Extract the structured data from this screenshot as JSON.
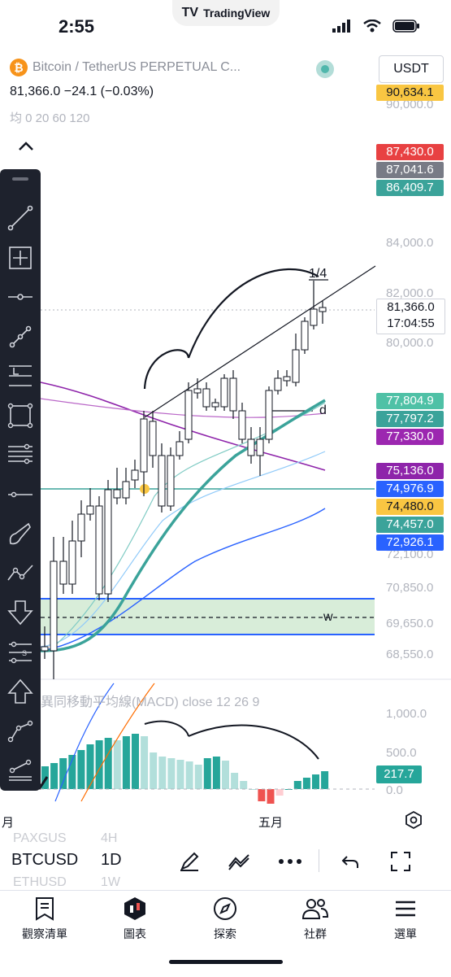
{
  "status": {
    "time": "2:55",
    "app_name": "TradingView"
  },
  "chart": {
    "symbol_title": "Bitcoin / TetherUS PERPETUAL C...",
    "price_line": "81,366.0  −24.1 (−0.03%)",
    "ma_legend": "均 0 20 60 120",
    "currency": "USDT",
    "colors": {
      "up": "#26a69a",
      "down": "#ef5350",
      "accent_red": "#e84142",
      "teal": "#3ba39a",
      "purple": "#7b1fa2",
      "blue": "#2962ff",
      "yellow": "#f9c642"
    },
    "price_tags": [
      {
        "value": "90,634.1",
        "color": "#f9c642",
        "text": "#131722"
      },
      {
        "value": "87,430.0",
        "color": "#e84142",
        "text": "#ffffff"
      },
      {
        "value": "87,041.6",
        "color": "#787b86",
        "text": "#ffffff"
      },
      {
        "value": "86,409.7",
        "color": "#3ba39a",
        "text": "#ffffff"
      },
      {
        "value": "77,804.9",
        "color": "#4fc1a6",
        "text": "#ffffff"
      },
      {
        "value": "77,797.2",
        "color": "#3ba39a",
        "text": "#ffffff"
      },
      {
        "value": "77,330.0",
        "color": "#9c27b0",
        "text": "#ffffff"
      },
      {
        "value": "75,136.0",
        "color": "#8e24aa",
        "text": "#ffffff"
      },
      {
        "value": "74,976.9",
        "color": "#2962ff",
        "text": "#ffffff"
      },
      {
        "value": "74,480.0",
        "color": "#f9c642",
        "text": "#131722"
      },
      {
        "value": "74,457.0",
        "color": "#3ba39a",
        "text": "#ffffff"
      },
      {
        "value": "72,926.1",
        "color": "#2962ff",
        "text": "#ffffff"
      }
    ],
    "axis_labels": [
      "90,000.0",
      "84,000.0",
      "82,000.0",
      "80,000.0",
      "72,100.0",
      "70,850.0",
      "69,650.0",
      "68,550.0"
    ],
    "current_price": "81,366.0",
    "countdown": "17:04:55",
    "annotations": {
      "fraction": "1/4",
      "d_label": "d",
      "w_label": "w"
    },
    "macd_title": "異同移動平均線(MACD) close 12 26 9",
    "macd_axis": [
      "1,000.0",
      "500.0",
      "0.0"
    ],
    "macd_value": "217.7",
    "time_labels": [
      "月",
      "五月"
    ]
  },
  "toolbar": {
    "tools": [
      "trend-line-icon",
      "cross-move-icon",
      "horizontal-ray-icon",
      "fib-retracement-icon",
      "price-label-icon",
      "rectangle-icon",
      "pitchfork-icon",
      "horizontal-line-icon",
      "brush-icon",
      "pattern-icon",
      "arrow-down-icon",
      "projection-icon",
      "arrow-up-icon",
      "path-icon",
      "forecast-icon"
    ]
  },
  "bottom_bar": {
    "symbol": "BTCUSD",
    "interval": "1D",
    "ghost_above_symbol": "PAXGUS",
    "ghost_above_interval": "4H",
    "ghost_below_symbol": "ETHUSD",
    "ghost_below_interval": "1W"
  },
  "nav": [
    {
      "label": "觀察清單",
      "icon": "watchlist-icon"
    },
    {
      "label": "圖表",
      "icon": "chart-icon"
    },
    {
      "label": "探索",
      "icon": "compass-icon"
    },
    {
      "label": "社群",
      "icon": "community-icon"
    },
    {
      "label": "選單",
      "icon": "menu-icon"
    }
  ]
}
